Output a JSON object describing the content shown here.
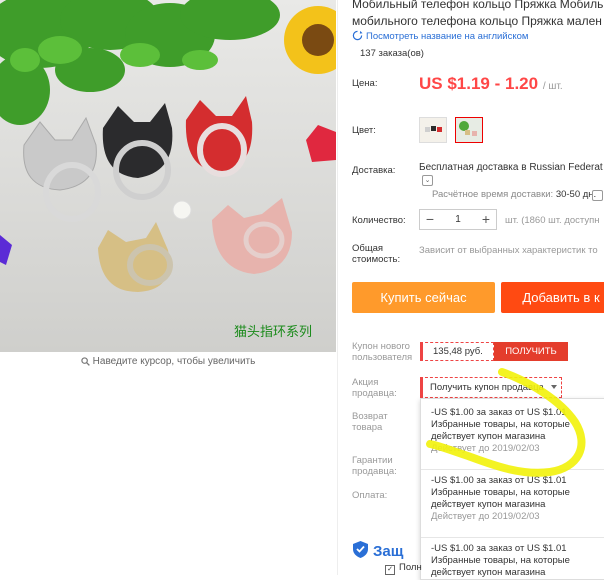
{
  "product": {
    "title_line1": "Мобильный телефон кольцо Пряжка Мобильн",
    "title_line2": "мобильного телефона кольцо Пряжка мален",
    "translate_link": "Посмотреть название на английском",
    "orders": "137 заказа(ов)",
    "image_caption": "猫头指环系列",
    "zoom_hint": "Наведите курсор, чтобы увеличить",
    "colors": {
      "accent_red": "#ff4747",
      "buy_orange": "#ff9a2b",
      "cart_orange": "#ff4a12",
      "link_blue": "#2a6fd6",
      "highlighter": "#f2f20a"
    }
  },
  "price": {
    "label": "Цена:",
    "value": "US $1.19 - 1.20",
    "unit": "/ шт."
  },
  "color": {
    "label": "Цвет:",
    "selected_index": 1
  },
  "delivery": {
    "label": "Доставка:",
    "value": "Бесплатная доставка в Russian Federat",
    "estimate_label": "Расчётное время доставки:",
    "estimate_days": "30-50 дн."
  },
  "quantity": {
    "label": "Количество:",
    "value": "1",
    "minus": "−",
    "plus": "+",
    "available": "шт. (1860 шт. доступн"
  },
  "total": {
    "label_line1": "Общая",
    "label_line2": "стоимость:",
    "value": "Зависит от выбранных характеристик то"
  },
  "buttons": {
    "buy": "Купить сейчас",
    "cart": "Добавить в к"
  },
  "new_user_coupon": {
    "label_line1": "Купон нового",
    "label_line2": "пользователя",
    "amount": "135,48 руб.",
    "get": "ПОЛУЧИТЬ"
  },
  "seller_promo": {
    "label_line1": "Акция",
    "label_line2": "продавца:",
    "selector": "Получить купон продавца",
    "coupons": [
      {
        "line1": "-US $1.00 за заказ от US $1.01",
        "line2": "Избранные товары, на которые",
        "line3": "действует купон магазина",
        "valid": "Действует до 2019/02/03"
      },
      {
        "line1": "-US $1.00 за заказ от US $1.01",
        "line2": "Избранные товары, на которые",
        "line3": "действует купон магазина",
        "valid": "Действует до 2019/02/03"
      },
      {
        "line1": "-US $1.00 за заказ от US $1.01",
        "line2": "Избранные товары, на которые",
        "line3": "действует купон магазина",
        "valid": ""
      }
    ]
  },
  "side_labels": {
    "return_line1": "Возврат",
    "return_line2": "товара",
    "guarantee_line1": "Гарантии",
    "guarantee_line2": "продавца:",
    "payment": "Оплата:"
  },
  "protection": {
    "title": "Защ",
    "sub": "Полн"
  }
}
